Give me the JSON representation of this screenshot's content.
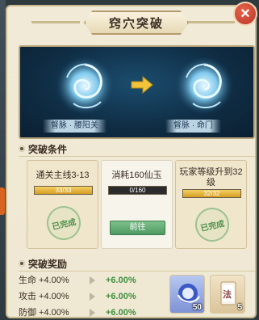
{
  "title": "窍穴突破",
  "close_icon": "close-icon",
  "scene": {
    "from_label": "督脉 · 腰阳关",
    "to_label": "督脉 · 命门"
  },
  "conditions": {
    "header": "突破条件",
    "cards": [
      {
        "title": "通关主线3-13",
        "progress_text": "33/33",
        "progress": 1.0,
        "status": "已完成"
      },
      {
        "title": "消耗160仙玉",
        "progress_text": "0/160",
        "progress": 0.0,
        "button": "前往"
      },
      {
        "title": "玩家等级升到32级",
        "progress_text": "32/32",
        "progress": 1.0,
        "status": "已完成"
      }
    ]
  },
  "rewards": {
    "header": "突破奖励",
    "stats": [
      {
        "label": "生命 +4.00%",
        "next": "+6.00%"
      },
      {
        "label": "攻击 +4.00%",
        "next": "+6.00%"
      },
      {
        "label": "防御 +4.00%",
        "next": "+6.00%"
      }
    ],
    "items": [
      {
        "icon": "spirit-orb-icon",
        "count": "50"
      },
      {
        "icon": "dharma-scroll-icon",
        "badge": "法",
        "count": "5"
      }
    ]
  },
  "colors": {
    "accent_green": "#3f8f3f",
    "progress_gold": "#f4d061",
    "close_red": "#d04a38"
  }
}
